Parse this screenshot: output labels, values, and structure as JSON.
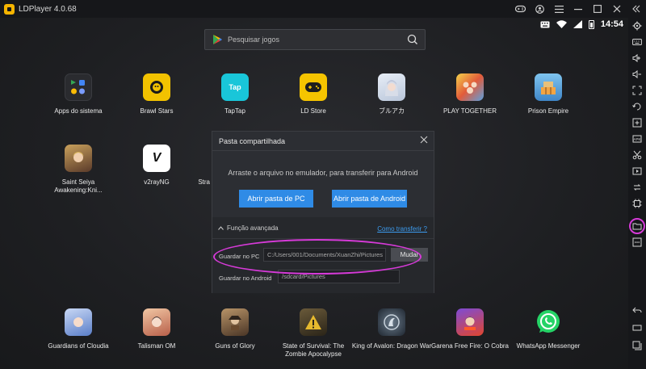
{
  "window": {
    "title": "LDPlayer 4.0.68"
  },
  "status": {
    "time": "14:54"
  },
  "search": {
    "placeholder": "Pesquisar jogos"
  },
  "apps_row1": [
    {
      "label": "Apps do sistema",
      "color": "#2a2b2f"
    },
    {
      "label": "Brawl Stars",
      "color": "#f2c200"
    },
    {
      "label": "TapTap",
      "color": "#19c6d9",
      "text": "Tap"
    },
    {
      "label": "LD Store",
      "color": "#f5c400"
    },
    {
      "label": "ブルアカ",
      "color": "#c9d6e6"
    },
    {
      "label": "PLAY TOGETHER",
      "color": "#e25b3a"
    },
    {
      "label": "Prison Empire",
      "color": "#4aa8d8"
    }
  ],
  "apps_row2": [
    {
      "label": "Saint Seiya Awakening:Kni...",
      "color": "#8a6a3c"
    },
    {
      "label": "v2rayNG",
      "color": "#ffffff",
      "text": "V"
    },
    {
      "label": "Stra",
      "color": "#3a3a3a"
    }
  ],
  "apps_row3": [
    {
      "label": "Guardians of Cloudia",
      "color": "#6c8fd8"
    },
    {
      "label": "Talisman OM",
      "color": "#d88a5a"
    },
    {
      "label": "Guns of Glory",
      "color": "#8a6a4a"
    },
    {
      "label": "State of Survival: The Zombie Apocalypse",
      "color": "#c9a23a"
    },
    {
      "label": "King of Avalon: Dragon War",
      "color": "#3a4a5a"
    },
    {
      "label": "Garena Free Fire: O Cobra",
      "color": "#d9572e"
    },
    {
      "label": "WhatsApp Messenger",
      "color": "#25d366"
    }
  ],
  "modal": {
    "title": "Pasta compartilhada",
    "description": "Arraste o arquivo no emulador, para transferir para Android",
    "open_pc_label": "Abrir pasta de PC",
    "open_android_label": "Abrir pasta de Android",
    "advanced_label": "Função avançada",
    "how_link": "Como transferir ?",
    "save_pc_label": "Guardar no PC",
    "save_pc_path": "C:/Users/001/Documents/XuanZhi/Pictures",
    "change_label": "Mudar",
    "save_android_label": "Guardar no Android",
    "save_android_path": "/sdcard/Pictures"
  },
  "colors": {
    "accent_blue": "#2f8be6",
    "highlight": "#d63ad8",
    "link": "#3c9cf0"
  },
  "sidebar_icons": [
    "settings-icon",
    "keyboard-icon",
    "volume-up-icon",
    "volume-down-icon",
    "fullscreen-icon",
    "rotate-icon",
    "add-app-icon",
    "apk-icon",
    "scissors-icon",
    "video-icon",
    "sync-icon",
    "macro-icon",
    "folder-icon",
    "more-icon",
    "back-icon",
    "home-icon",
    "recent-apps-icon"
  ]
}
